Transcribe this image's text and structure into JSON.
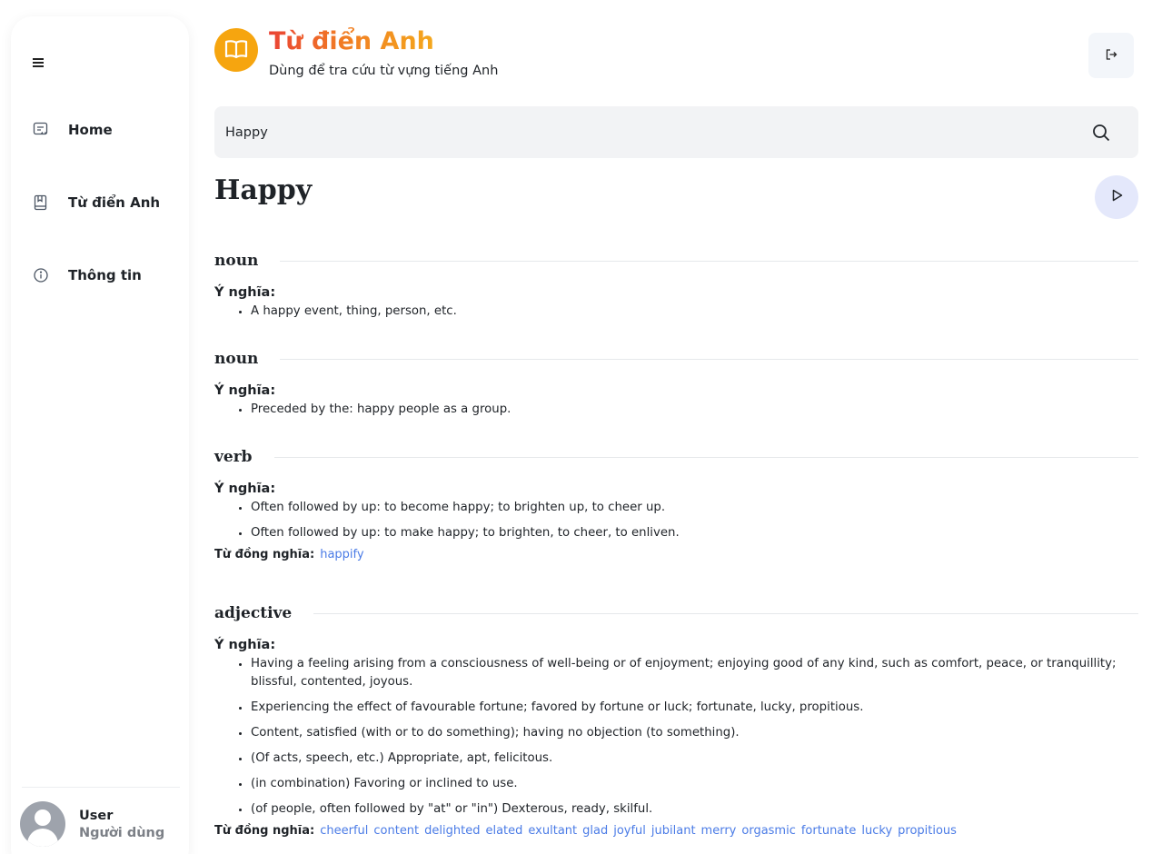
{
  "sidebar": {
    "items": [
      {
        "label": "Home",
        "icon": "message-code-icon"
      },
      {
        "label": "Từ điển Anh",
        "icon": "bookmark-book-icon"
      },
      {
        "label": "Thông tin",
        "icon": "info-circle-icon"
      }
    ],
    "user": {
      "name": "User",
      "role": "Người dùng"
    }
  },
  "header": {
    "title": "Từ điển Anh",
    "subtitle": "Dùng để tra cứu từ vựng tiếng Anh",
    "logo_icon": "open-book-icon",
    "logout_icon": "logout-icon",
    "brand_color": "#f6a50f"
  },
  "search": {
    "value": "Happy",
    "icon": "search-icon"
  },
  "word": {
    "text": "Happy",
    "audio_icon": "play-icon"
  },
  "labels": {
    "meaning": "Ý nghĩa:",
    "synonyms": "Từ đồng nghĩa:"
  },
  "entries": [
    {
      "pos": "noun",
      "definitions": [
        "A happy event, thing, person, etc."
      ],
      "synonyms": []
    },
    {
      "pos": "noun",
      "definitions": [
        "Preceded by the: happy people as a group."
      ],
      "synonyms": []
    },
    {
      "pos": "verb",
      "definitions": [
        "Often followed by up: to become happy; to brighten up, to cheer up.",
        "Often followed by up: to make happy; to brighten, to cheer, to enliven."
      ],
      "synonyms": [
        "happify"
      ]
    },
    {
      "pos": "adjective",
      "definitions": [
        "Having a feeling arising from a consciousness of well-being or of enjoyment; enjoying good of any kind, such as comfort, peace, or tranquillity; blissful, contented, joyous.",
        "Experiencing the effect of favourable fortune; favored by fortune or luck; fortunate, lucky, propitious.",
        "Content, satisfied (with or to do something); having no objection (to something).",
        "(Of acts, speech, etc.) Appropriate, apt, felicitous.",
        "(in combination) Favoring or inclined to use.",
        "(of people, often followed by \"at\" or \"in\") Dexterous, ready, skilful."
      ],
      "synonyms": [
        "cheerful",
        "content",
        "delighted",
        "elated",
        "exultant",
        "glad",
        "joyful",
        "jubilant",
        "merry",
        "orgasmic",
        "fortunate",
        "lucky",
        "propitious"
      ]
    }
  ]
}
